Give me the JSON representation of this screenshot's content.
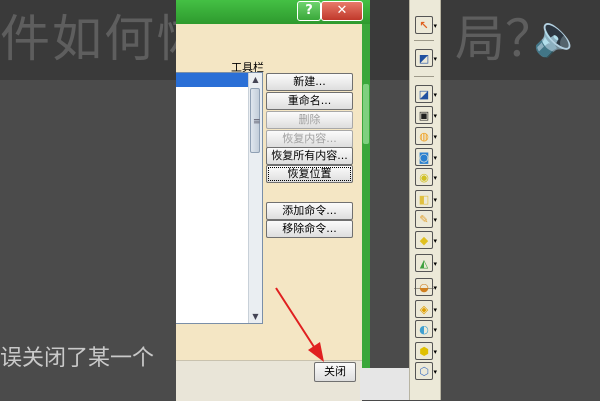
{
  "background": {
    "title_text": "件如何恢",
    "title_right": "局？",
    "subtitle_bottom": "误关闭了某一个"
  },
  "dialog": {
    "help_glyph": "?",
    "close_glyph": "✕",
    "panel_label": "工具栏",
    "buttons": [
      {
        "label": "新建...",
        "enabled": true
      },
      {
        "label": "重命名...",
        "enabled": true
      },
      {
        "label": "删除",
        "enabled": false
      },
      {
        "label": "恢复内容...",
        "enabled": false
      },
      {
        "label": "恢复所有内容...",
        "enabled": true
      },
      {
        "label": "恢复位置",
        "enabled": true
      },
      {
        "label": "添加命令...",
        "enabled": true
      },
      {
        "label": "移除命令...",
        "enabled": true
      }
    ],
    "close_label": "关闭"
  },
  "toolbar": {
    "tools": [
      {
        "icon": "cursor-arrow-icon",
        "glyph": "↖",
        "color": "#e06020"
      },
      {
        "icon": "sketch-plane-icon",
        "glyph": "◩",
        "color": "#2050a0"
      },
      {
        "icon": "sketch-icon",
        "glyph": "◪",
        "color": "#2050a0"
      },
      {
        "icon": "part-icon",
        "glyph": "▣",
        "color": "#202020"
      },
      {
        "icon": "pocket-icon",
        "glyph": "◍",
        "color": "#f0a020"
      },
      {
        "icon": "pad-icon",
        "glyph": "◙",
        "color": "#2a80d0"
      },
      {
        "icon": "shaft-icon",
        "glyph": "◉",
        "color": "#d0c020"
      },
      {
        "icon": "rib-icon",
        "glyph": "◧",
        "color": "#e0c040"
      },
      {
        "icon": "edit-icon",
        "glyph": "✎",
        "color": "#e0a030"
      },
      {
        "icon": "hole-icon",
        "glyph": "◆",
        "color": "#e0c020"
      },
      {
        "icon": "chamfer-icon",
        "glyph": "◭",
        "color": "#40a040"
      },
      {
        "icon": "fillet-icon",
        "glyph": "◒",
        "color": "#d08020"
      },
      {
        "icon": "draft-icon",
        "glyph": "◈",
        "color": "#e0a000"
      },
      {
        "icon": "shell-icon",
        "glyph": "◐",
        "color": "#40a0d0"
      },
      {
        "icon": "thickness-icon",
        "glyph": "⬢",
        "color": "#e0c000"
      },
      {
        "icon": "transform-icon",
        "glyph": "⬡",
        "color": "#4070c0"
      }
    ]
  }
}
